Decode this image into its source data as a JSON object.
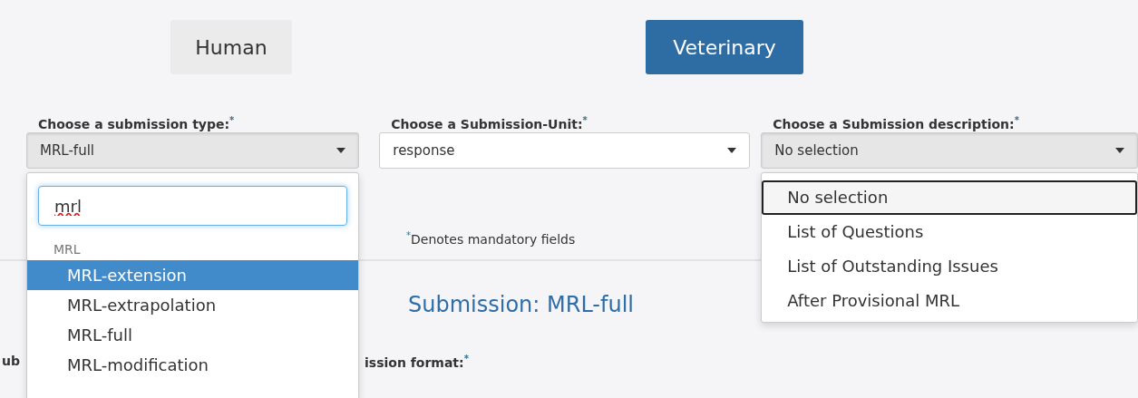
{
  "tabs": [
    {
      "label": "Human",
      "selected": false
    },
    {
      "label": "Veterinary",
      "selected": true
    }
  ],
  "fields": [
    {
      "label": "Choose a submission type:$^{*}$",
      "value": "MRL-full",
      "open": true,
      "dropdown": {
        "kind": "searchable",
        "search": "mrl",
        "spellcheck_error": true,
        "groups": [
          {
            "label": "MRL",
            "options": [
              {
                "label": "MRL-extension",
                "selected": true
              },
              {
                "label": "MRL-extrapolation",
                "selected": false
              },
              {
                "label": "MRL-full",
                "selected": false
              },
              {
                "label": "MRL-modification",
                "selected": false
              }
            ]
          }
        ]
      }
    },
    {
      "label": "Choose a Submission-Unit:$^{*}$",
      "value": "response",
      "open": false
    },
    {
      "label": "Choose a Submission description:$^{*}$",
      "value": "No selection",
      "open": true,
      "dropdown": {
        "kind": "plain",
        "options": [
          {
            "label": "No selection",
            "selected": true
          },
          {
            "label": "List of Questions",
            "selected": false
          },
          {
            "label": "List of Outstanding Issues",
            "selected": false
          },
          {
            "label": "After Provisional MRL",
            "selected": false
          }
        ]
      }
    }
  ],
  "note": "$^{*}$Denotes mandatory fields",
  "heading": "Submission: MRL-full",
  "bottom_labels": [
    "ub",
    "ission format:$^{*}$"
  ]
}
